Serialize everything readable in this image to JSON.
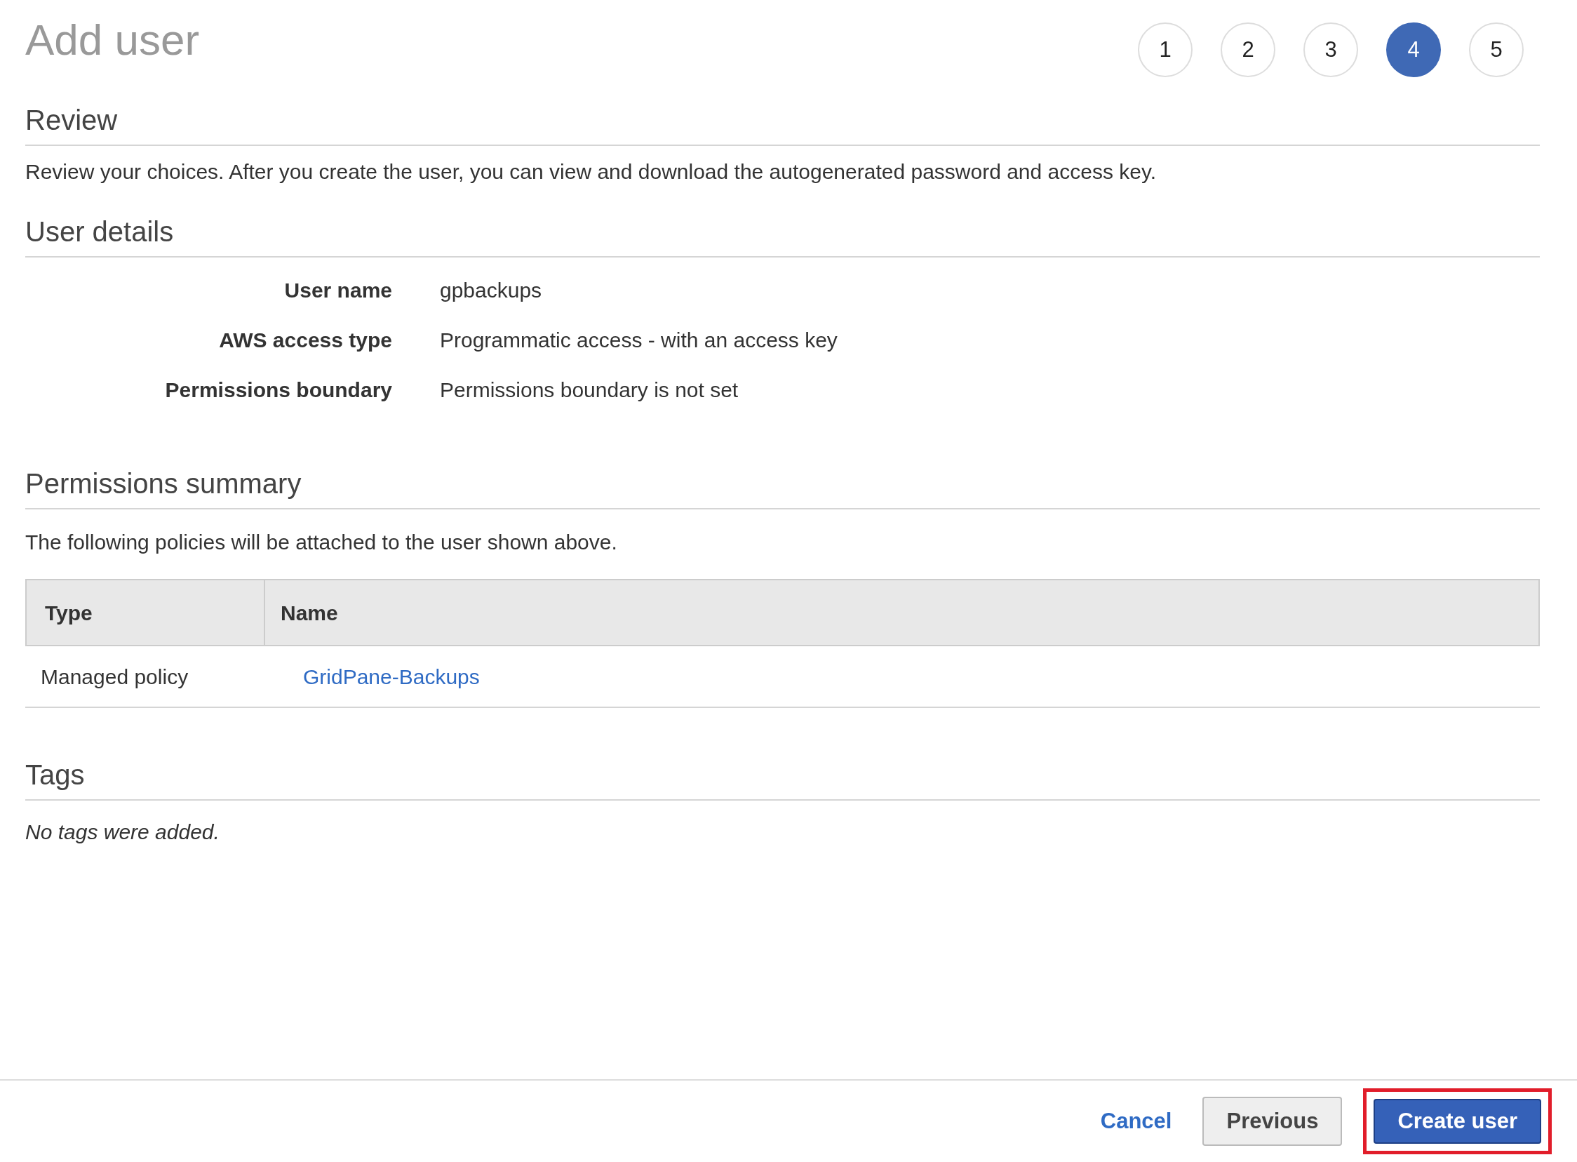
{
  "page": {
    "title": "Add user"
  },
  "steps": [
    {
      "label": "1",
      "selected": false
    },
    {
      "label": "2",
      "selected": false
    },
    {
      "label": "3",
      "selected": false
    },
    {
      "label": "4",
      "selected": true
    },
    {
      "label": "5",
      "selected": false
    }
  ],
  "review": {
    "heading": "Review",
    "intro": "Review your choices. After you create the user, you can view and download the autogenerated password and access key."
  },
  "user_details": {
    "heading": "User details",
    "rows": [
      {
        "label": "User name",
        "value": "gpbackups"
      },
      {
        "label": "AWS access type",
        "value": "Programmatic access - with an access key"
      },
      {
        "label": "Permissions boundary",
        "value": "Permissions boundary is not set"
      }
    ]
  },
  "permissions_summary": {
    "heading": "Permissions summary",
    "intro": "The following policies will be attached to the user shown above.",
    "table": {
      "columns": [
        "Type",
        "Name"
      ],
      "rows": [
        {
          "type": "Managed policy",
          "name": "GridPane-Backups"
        }
      ]
    }
  },
  "tags": {
    "heading": "Tags",
    "empty_message": "No tags were added."
  },
  "footer": {
    "cancel": "Cancel",
    "previous": "Previous",
    "create": {
      "label": "Create user",
      "highlighted": true
    }
  }
}
